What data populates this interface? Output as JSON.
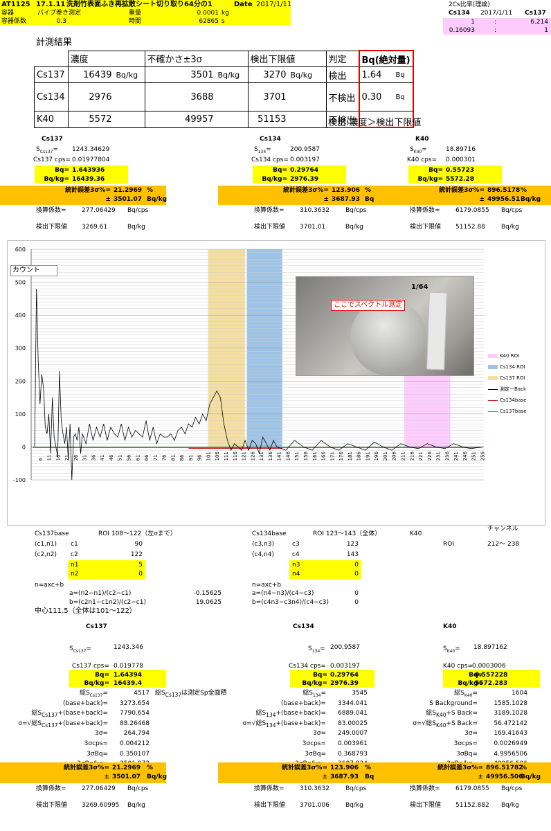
{
  "header": {
    "id": "AT1125",
    "date_code": "17.1.11",
    "title": "洗剤竹表面ふき再拡散シート切り取り64分の1",
    "date_label": "Date",
    "date_value": "2017/1/11",
    "container_label": "容器",
    "container_value": "パイプ巻き測定",
    "weight_label": "重量",
    "weight_value": "0.0001",
    "weight_unit": "kg",
    "coef_label": "容器係数",
    "coef_value": "0.3",
    "time_label": "時間",
    "time_value": "62865",
    "time_unit": "s"
  },
  "ratio": {
    "title": "2Cs比率(理論)",
    "cs134": "Cs134",
    "date": "2017/1/11",
    "cs137": "Cs137",
    "r1a": "1",
    "r1sep": ":",
    "r1b": "6.214",
    "r2a": "0.16093",
    "r2sep": ":",
    "r2b": "1"
  },
  "results": {
    "title": "計測結果",
    "headers": [
      "",
      "濃度",
      "不確かさ±3σ",
      "検出下限値",
      "判定",
      "Bq(絶対量)"
    ],
    "rows": [
      {
        "nuc": "Cs137",
        "conc": "16439",
        "u1": "Bq/kg",
        "unc": "3501",
        "u2": "Bq/kg",
        "lim": "3270",
        "u3": "Bq/kg",
        "judge": "検出",
        "abs": "1.64",
        "absu": "Bq"
      },
      {
        "nuc": "Cs134",
        "conc": "2976",
        "u1": "",
        "unc": "3688",
        "u2": "",
        "lim": "3701",
        "u3": "",
        "judge": "不検出",
        "abs": "0.30",
        "absu": "Bq"
      },
      {
        "nuc": "K40",
        "conc": "5572",
        "u1": "",
        "unc": "49957",
        "u2": "",
        "lim": "51153",
        "u3": "",
        "judge": "不検出",
        "abs": "",
        "absu": ""
      }
    ],
    "note": "検出:濃度＞検出下限値"
  },
  "summary": {
    "cs137": {
      "title": "Cs137",
      "s_label": "S",
      "s_sub": "Cs137",
      "s_val": "1243.34629",
      "cps_label": "Cs137 cps=",
      "cps_val": "0.01977804",
      "bq_label": "Bq=",
      "bq_val": "1.643936",
      "bqkg_label": "Bq/kg=",
      "bqkg_val": "16439.36",
      "err_label": "統計誤差3σ%=",
      "err_val": "21.2969",
      "err_unit": "%",
      "pm": "±",
      "pm_val": "3501.07",
      "pm_unit": "Bq/kg",
      "conv_label": "換算係数=",
      "conv_val": "277.06429",
      "conv_unit": "Bq/cps",
      "lim_label": "検出下限値",
      "lim_val": "3269.61",
      "lim_unit": "Bq/kg"
    },
    "cs134": {
      "title": "Cs134",
      "s_label": "S",
      "s_sub": "134",
      "s_val": "200.9587",
      "cps_label": "Cs134 cps=",
      "cps_val": "0.003197",
      "bq_label": "Bq=",
      "bq_val": "0.29764",
      "bqkg_label": "Bq/kg=",
      "bqkg_val": "2976.39",
      "err_label": "統計誤差3σ%=",
      "err_val": "123.906",
      "err_unit": "%",
      "pm": "±",
      "pm_val": "3687.93",
      "pm_unit": "Bq/kg",
      "conv_label": "換算係数=",
      "conv_val": "310.3632",
      "conv_unit": "Bq/cps",
      "lim_label": "検出下限値",
      "lim_val": "3701.01",
      "lim_unit": "Bq/kg"
    },
    "k40": {
      "title": "K40",
      "s_label": "S",
      "s_sub": "K40",
      "s_val": "18.89716",
      "cps_label": "K40  cps=",
      "cps_val": "0.000301",
      "bq_label": "Bq=",
      "bq_val": "0.55723",
      "bqkg_label": "Bq/kg=",
      "bqkg_val": "5572.28",
      "err_label": "統計誤差3σ%=",
      "err_val": "896.5178",
      "err_unit": "%",
      "pm": "±",
      "pm_val": "49956.51",
      "pm_unit": "Bq/kg",
      "conv_label": "換算係数=",
      "conv_val": "6179.0855",
      "conv_unit": "Bq/cps",
      "lim_label": "検出下限値",
      "lim_val": "51152.88",
      "lim_unit": "Bq/kg"
    }
  },
  "chart": {
    "ylabel": "カウント",
    "photo_caption": "ここでスペクトル測定",
    "photo_label": "1/64",
    "legend": [
      {
        "name": "K40 ROI",
        "color": "#ffccff"
      },
      {
        "name": "Cs134 ROI",
        "color": "#9dc3e6"
      },
      {
        "name": "Cs137 ROI",
        "color": "#f5dfa0"
      },
      {
        "name": "測定ーBack",
        "color": "#000000"
      },
      {
        "name": "Cs134base",
        "color": "#c00000"
      },
      {
        "name": "Cs137base",
        "color": "#00a040"
      }
    ]
  },
  "chart_data": {
    "type": "line",
    "title": "",
    "xlabel": "",
    "ylabel": "カウント",
    "ylim": [
      -100,
      600
    ],
    "yticks": [
      -100,
      0,
      100,
      200,
      300,
      400,
      500,
      600
    ],
    "xticks": [
      6,
      11,
      16,
      21,
      26,
      31,
      36,
      41,
      46,
      51,
      56,
      61,
      66,
      71,
      76,
      81,
      86,
      91,
      96,
      101,
      106,
      111,
      116,
      121,
      126,
      131,
      136,
      141,
      146,
      151,
      156,
      161,
      166,
      171,
      176,
      181,
      186,
      191,
      196,
      201,
      206,
      211,
      216,
      221,
      226,
      231,
      236,
      241,
      246,
      251,
      256
    ],
    "xlim": [
      1,
      257
    ],
    "roi": [
      {
        "name": "Cs137 ROI",
        "x": [
          101,
          122
        ]
      },
      {
        "name": "Cs134 ROI",
        "x": [
          123,
          143
        ]
      },
      {
        "name": "K40 ROI",
        "x": [
          212,
          238
        ]
      }
    ],
    "series": [
      {
        "name": "測定ーBack",
        "x": [
          3,
          4,
          5,
          6,
          7,
          8,
          9,
          10,
          11,
          12,
          13,
          14,
          15,
          16,
          17,
          18,
          19,
          20,
          21,
          22,
          23,
          24,
          25,
          26,
          27,
          28,
          29,
          30,
          32,
          34,
          36,
          38,
          40,
          42,
          44,
          46,
          48,
          50,
          52,
          54,
          56,
          58,
          60,
          62,
          64,
          66,
          68,
          70,
          72,
          74,
          76,
          78,
          80,
          82,
          84,
          86,
          88,
          90,
          92,
          94,
          96,
          98,
          100,
          102,
          104,
          106,
          108,
          110,
          112,
          114,
          116,
          118,
          120,
          122,
          124,
          126,
          128,
          130,
          132,
          134,
          136,
          138,
          140,
          145,
          150,
          155,
          160,
          165,
          170,
          175,
          180,
          185,
          190,
          195,
          200,
          205,
          210,
          215,
          220,
          225,
          230,
          235,
          240,
          245,
          250,
          255
        ],
        "values": [
          0,
          480,
          260,
          130,
          220,
          180,
          60,
          40,
          100,
          -20,
          150,
          30,
          0,
          -30,
          230,
          80,
          40,
          10,
          60,
          -40,
          70,
          -100,
          30,
          40,
          20,
          60,
          -20,
          40,
          10,
          70,
          20,
          60,
          30,
          70,
          20,
          60,
          40,
          30,
          70,
          20,
          60,
          30,
          50,
          40,
          30,
          80,
          20,
          60,
          10,
          40,
          30,
          30,
          40,
          20,
          50,
          60,
          40,
          70,
          60,
          90,
          70,
          100,
          80,
          130,
          150,
          170,
          150,
          70,
          20,
          -10,
          10,
          0,
          -10,
          20,
          -10,
          20,
          10,
          -20,
          30,
          10,
          -10,
          20,
          0,
          -10,
          20,
          0,
          -10,
          20,
          0,
          -10,
          10,
          0,
          -10,
          15,
          0,
          -10,
          10,
          0,
          -5,
          10,
          0,
          -5,
          10,
          0,
          -5,
          0
        ]
      },
      {
        "name": "Cs134base",
        "values": [
          0,
          0
        ]
      },
      {
        "name": "Cs137base",
        "values": [
          0,
          0
        ]
      }
    ]
  },
  "roi_params": {
    "cs137": {
      "label": "Cs137base",
      "roi": "ROI 108〜122（左σまで）",
      "r1a": "(c1,n1)",
      "r1b": "c1",
      "r1c": "90",
      "r2a": "(c2,n2)",
      "r2b": "c2",
      "r2c": "122",
      "n1": "n1",
      "n1v": "5",
      "n2": "n2",
      "n2v": "0",
      "eq": "n=axc+b",
      "a_label": "a=(n2−n1)/(c2−c1)",
      "a_val": "-0.15625",
      "b_label": "b=(c2n1−c1n2)/(c2−c1)",
      "b_val": "19.0625",
      "center": "中心111.5（全体は101〜122）"
    },
    "cs134": {
      "label": "Cs134base",
      "roi": "ROI 123〜143（全体）",
      "r1a": "(c3,n3)",
      "r1b": "c3",
      "r1c": "123",
      "r2a": "(c4,n4)",
      "r2b": "c4",
      "r2c": "143",
      "n3": "n3",
      "n3v": "0",
      "n4": "n4",
      "n4v": "0",
      "eq": "n=axc+b",
      "a_label": "a=(n4−n3)/(c4−c3)",
      "a_val": "0",
      "b_label": "b=(c4n3−c3n4)/(c4−c3)",
      "b_val": "0"
    },
    "k40": {
      "label": "K40",
      "channel": "チャンネル",
      "roi": "ROI",
      "range": "212〜 238"
    }
  },
  "detail": {
    "cs137": {
      "title": "Cs137",
      "s_val": "1243.346",
      "cps_label": "Cs137 cps=",
      "cps_val": "0.019778",
      "bq_val": "1.64394",
      "bqkg_val": "16439.4",
      "total_label": "総S",
      "total_sub": "Cs137",
      "total_val": "4517",
      "total_note": "総S<sub>Cs137</sub>は測定Sp全面積",
      "bb_label": "(base+back)=",
      "bb_val": "3273.654",
      "sum_label": "総S<sub>Cs137</sub>+(base+back)=",
      "sum_val": "7790.654",
      "sig_label": "σ=√総S<sub>Cs137</sub>+(base+back)=",
      "sig_val": "88.26468",
      "s3_label": "3σ=",
      "s3_val": "264.794",
      "s3cps_label": "3σcps=",
      "s3cps_val": "0.004212",
      "s3bq_label": "3σBq=",
      "s3bq_val": "0.350107",
      "s3bqkg_label": "3σBq/kg=",
      "s3bqkg_val": "3501.072",
      "err_val": "21.2969",
      "pm_val": "3501.07",
      "conv_val": "277.06429",
      "lim_val": "3269.60995"
    },
    "cs134": {
      "title": "Cs134",
      "s_val": "200.9587",
      "cps_label": "Cs134 cps=",
      "cps_val": "0.003197",
      "bq_val": "0.29764",
      "bqkg_val": "2976.39",
      "total_val": "3545",
      "bb_label": "(base+back)=",
      "bb_val": "3344.041",
      "sum_label": "総S<sub>134</sub>+(base+back)=",
      "sum_val": "6889.041",
      "sig_label": "σ=√総S<sub>134</sub>+(base+back)=",
      "sig_val": "83.00025",
      "s3_label": "3σ=",
      "s3_val": "249.0007",
      "s3cps_label": "3σcps=",
      "s3cps_val": "0.003961",
      "s3bq_label": "3σBq=",
      "s3bq_val": "0.368793",
      "s3bqkg_label": "3σBq/kg=",
      "s3bqkg_val": "3687.934",
      "err_val": "123.906",
      "pm_val": "3687.93",
      "conv_val": "310.3632",
      "lim_val": "3701.006"
    },
    "k40": {
      "title": "K40",
      "s_val": "18.897162",
      "cps_label": "K40  cps=",
      "cps_val": "0.0003006",
      "bq_val": "0.557228",
      "bqkg_val": "5572.283",
      "total_val": "1604",
      "bb_label": "S Background=",
      "bb_val": "1585.1028",
      "sum_label": "総S<sub>K40</sub>+S Back=",
      "sum_val": "3189.1028",
      "sig_label": "σ=√総S<sub>K40</sub>+S Back=",
      "sig_val": "56.472142",
      "s3_label": "3σ=",
      "s3_val": "169.41643",
      "s3cps_label": "3σcps=",
      "s3cps_val": "0.0026949",
      "s3bq_label": "3σBq=",
      "s3bq_val": "4.9956506",
      "s3bqkg_label": "3σBq/kg=",
      "s3bqkg_val": "49956.506",
      "err_val": "896.51782",
      "pm_val": "49956.506",
      "conv_val": "6179.0855",
      "lim_val": "51152.882"
    }
  }
}
